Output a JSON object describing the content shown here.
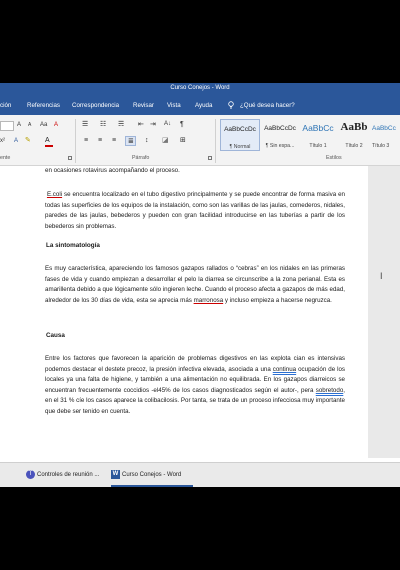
{
  "window": {
    "title": "Curso Conejos - Word"
  },
  "tabs": [
    {
      "label": "ción"
    },
    {
      "label": "Referencias"
    },
    {
      "label": "Correspondencia"
    },
    {
      "label": "Revisar"
    },
    {
      "label": "Vista"
    },
    {
      "label": "Ayuda"
    }
  ],
  "tell_me": "¿Qué desea hacer?",
  "ribbon": {
    "groups": {
      "left": "ente",
      "paragraph": "Párrafo",
      "styles": "Estilos"
    },
    "styles": [
      {
        "sample": "AaBbCcDc",
        "name": "¶ Normal"
      },
      {
        "sample": "AaBbCcDc",
        "name": "¶ Sin espa..."
      },
      {
        "sample": "AaBbCc",
        "name": "Título 1"
      },
      {
        "sample": "AaBb",
        "name": "Título 2"
      },
      {
        "sample": "AaBbCc",
        "name": "Título 3"
      }
    ]
  },
  "document": {
    "line0": "en ocasiones rotavirus acompañando el proceso.",
    "p1": {
      "ecoli": "E.coli",
      "rest": " se encuentra localizado en el tubo digestivo principalmente y se puede encontrar de forma masiva en todas las superficies de los equipos de la instalación, como son las varillas de las jaulas, comederos, nidales, paredes de las jaulas, bebederos y pueden con gran facilidad introducirse en las tuberías a partir de los bebederos sin problemas."
    },
    "h2": "La sintomatología",
    "p2": {
      "a": " Es muy característica, apareciendo los famosos gazapos rallados o “cebras” en los nidales en las primeras fases de vida y cuando empiezan a desarrollar el pelo la diarrea se circunscribe a la zona perianal. Esta es amarillenta debido a que lógicamente sólo ingieren leche. Cuando el proceso afecta a gazapos de más edad, alrededor de los 30 días de vida, esta se aprecia más ",
      "marronosa": "marronosa",
      "b": " y incluso empieza a hacerse negruzca."
    },
    "h3": "Causa",
    "p3": {
      "a": "Entre los factores que favorecen la aparición de problemas digestivos en las explota cian es intensivas podemos destacar el destete precoz, la presión infectiva elevada, asociada a una ",
      "continua": "continua",
      "b": " ocupación de los locales ya una falta de higiene, y también a una alimentación no equilibrada. En los gazapos diarreicos se encuentran frecuentemente coccidios -el45% de los casos diagnosticados según el autor-, pera ",
      "sobretodo": "sobretodo",
      "c": ", en el 31 % cíe los casos aparece la colibacilosis. Por tanta, se trata de un proceso infecciosa muy importante que debe ser tenido en cuenta."
    }
  },
  "taskbar": {
    "items": [
      {
        "label": "Controles de reunión ..."
      },
      {
        "label": "Curso Conejos - Word"
      }
    ]
  },
  "colors": {
    "word_blue": "#2b579a",
    "teams_purple": "#4b53bc"
  }
}
